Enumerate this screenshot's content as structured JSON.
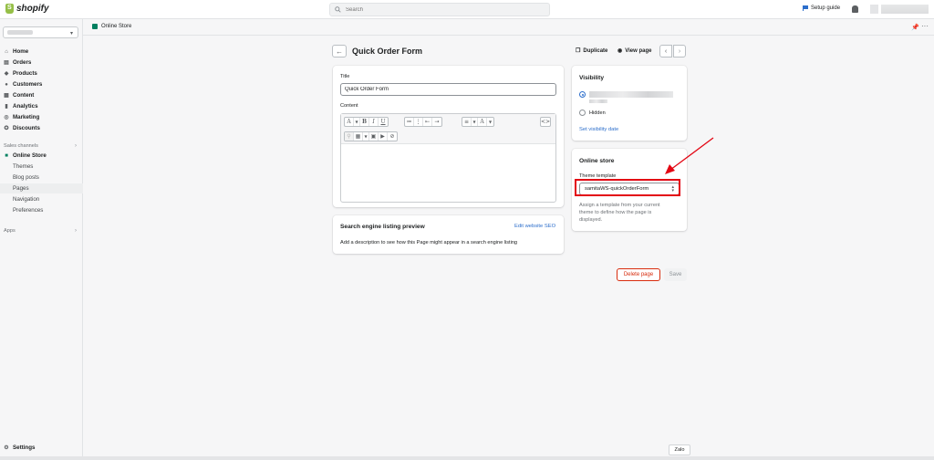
{
  "topbar": {
    "logo_text": "shopify",
    "search_placeholder": "Search",
    "setup_guide": "Setup guide"
  },
  "sidebar": {
    "items": [
      {
        "label": "Home",
        "icon": "home-icon"
      },
      {
        "label": "Orders",
        "icon": "orders-icon"
      },
      {
        "label": "Products",
        "icon": "tag-icon"
      },
      {
        "label": "Customers",
        "icon": "person-icon"
      },
      {
        "label": "Content",
        "icon": "content-icon"
      },
      {
        "label": "Analytics",
        "icon": "bar-chart-icon"
      },
      {
        "label": "Marketing",
        "icon": "target-icon"
      },
      {
        "label": "Discounts",
        "icon": "discount-icon"
      }
    ],
    "sales_channels_label": "Sales channels",
    "online_store": "Online Store",
    "online_store_sub": [
      "Themes",
      "Blog posts",
      "Pages",
      "Navigation",
      "Preferences"
    ],
    "apps_label": "Apps",
    "settings": "Settings"
  },
  "subbar": {
    "title": "Online Store"
  },
  "page": {
    "title": "Quick Order Form",
    "duplicate": "Duplicate",
    "view_page": "View page"
  },
  "main_card": {
    "title_label": "Title",
    "title_value": "Quick Order Form",
    "content_label": "Content"
  },
  "seo_card": {
    "title": "Search engine listing preview",
    "edit_link": "Edit website SEO",
    "description": "Add a description to see how this Page might appear in a search engine listing"
  },
  "visibility_card": {
    "title": "Visibility",
    "hidden_label": "Hidden",
    "set_date_link": "Set visibility date"
  },
  "online_store_card": {
    "title": "Online store",
    "template_label": "Theme template",
    "template_value": "samitaWS-quickOrderForm",
    "help_line1": "Assign a template from your current",
    "help_line2": "theme to define how the page is",
    "help_line3": "displayed."
  },
  "actions": {
    "delete": "Delete page",
    "save": "Save"
  },
  "widget": {
    "zalo": "Zalo"
  },
  "colors": {
    "accent": "#2c6ecb",
    "danger": "#d72c0d",
    "annotation": "#e30613",
    "brand": "#95bf47"
  }
}
